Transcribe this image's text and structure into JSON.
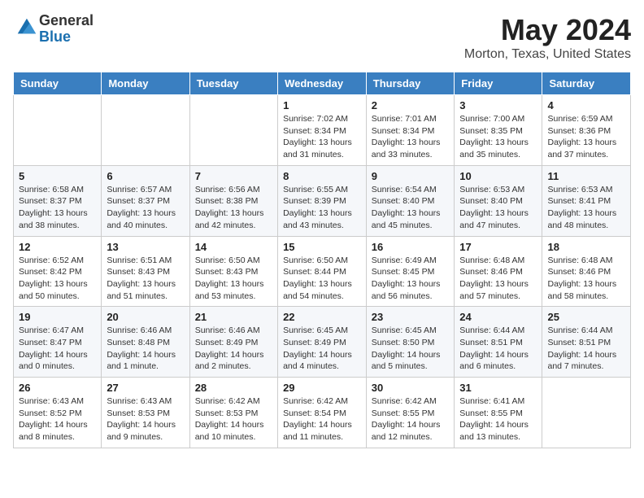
{
  "header": {
    "logo_general": "General",
    "logo_blue": "Blue",
    "title": "May 2024",
    "location": "Morton, Texas, United States"
  },
  "weekdays": [
    "Sunday",
    "Monday",
    "Tuesday",
    "Wednesday",
    "Thursday",
    "Friday",
    "Saturday"
  ],
  "weeks": [
    [
      {
        "day": "",
        "info": ""
      },
      {
        "day": "",
        "info": ""
      },
      {
        "day": "",
        "info": ""
      },
      {
        "day": "1",
        "info": "Sunrise: 7:02 AM\nSunset: 8:34 PM\nDaylight: 13 hours\nand 31 minutes."
      },
      {
        "day": "2",
        "info": "Sunrise: 7:01 AM\nSunset: 8:34 PM\nDaylight: 13 hours\nand 33 minutes."
      },
      {
        "day": "3",
        "info": "Sunrise: 7:00 AM\nSunset: 8:35 PM\nDaylight: 13 hours\nand 35 minutes."
      },
      {
        "day": "4",
        "info": "Sunrise: 6:59 AM\nSunset: 8:36 PM\nDaylight: 13 hours\nand 37 minutes."
      }
    ],
    [
      {
        "day": "5",
        "info": "Sunrise: 6:58 AM\nSunset: 8:37 PM\nDaylight: 13 hours\nand 38 minutes."
      },
      {
        "day": "6",
        "info": "Sunrise: 6:57 AM\nSunset: 8:37 PM\nDaylight: 13 hours\nand 40 minutes."
      },
      {
        "day": "7",
        "info": "Sunrise: 6:56 AM\nSunset: 8:38 PM\nDaylight: 13 hours\nand 42 minutes."
      },
      {
        "day": "8",
        "info": "Sunrise: 6:55 AM\nSunset: 8:39 PM\nDaylight: 13 hours\nand 43 minutes."
      },
      {
        "day": "9",
        "info": "Sunrise: 6:54 AM\nSunset: 8:40 PM\nDaylight: 13 hours\nand 45 minutes."
      },
      {
        "day": "10",
        "info": "Sunrise: 6:53 AM\nSunset: 8:40 PM\nDaylight: 13 hours\nand 47 minutes."
      },
      {
        "day": "11",
        "info": "Sunrise: 6:53 AM\nSunset: 8:41 PM\nDaylight: 13 hours\nand 48 minutes."
      }
    ],
    [
      {
        "day": "12",
        "info": "Sunrise: 6:52 AM\nSunset: 8:42 PM\nDaylight: 13 hours\nand 50 minutes."
      },
      {
        "day": "13",
        "info": "Sunrise: 6:51 AM\nSunset: 8:43 PM\nDaylight: 13 hours\nand 51 minutes."
      },
      {
        "day": "14",
        "info": "Sunrise: 6:50 AM\nSunset: 8:43 PM\nDaylight: 13 hours\nand 53 minutes."
      },
      {
        "day": "15",
        "info": "Sunrise: 6:50 AM\nSunset: 8:44 PM\nDaylight: 13 hours\nand 54 minutes."
      },
      {
        "day": "16",
        "info": "Sunrise: 6:49 AM\nSunset: 8:45 PM\nDaylight: 13 hours\nand 56 minutes."
      },
      {
        "day": "17",
        "info": "Sunrise: 6:48 AM\nSunset: 8:46 PM\nDaylight: 13 hours\nand 57 minutes."
      },
      {
        "day": "18",
        "info": "Sunrise: 6:48 AM\nSunset: 8:46 PM\nDaylight: 13 hours\nand 58 minutes."
      }
    ],
    [
      {
        "day": "19",
        "info": "Sunrise: 6:47 AM\nSunset: 8:47 PM\nDaylight: 14 hours\nand 0 minutes."
      },
      {
        "day": "20",
        "info": "Sunrise: 6:46 AM\nSunset: 8:48 PM\nDaylight: 14 hours\nand 1 minute."
      },
      {
        "day": "21",
        "info": "Sunrise: 6:46 AM\nSunset: 8:49 PM\nDaylight: 14 hours\nand 2 minutes."
      },
      {
        "day": "22",
        "info": "Sunrise: 6:45 AM\nSunset: 8:49 PM\nDaylight: 14 hours\nand 4 minutes."
      },
      {
        "day": "23",
        "info": "Sunrise: 6:45 AM\nSunset: 8:50 PM\nDaylight: 14 hours\nand 5 minutes."
      },
      {
        "day": "24",
        "info": "Sunrise: 6:44 AM\nSunset: 8:51 PM\nDaylight: 14 hours\nand 6 minutes."
      },
      {
        "day": "25",
        "info": "Sunrise: 6:44 AM\nSunset: 8:51 PM\nDaylight: 14 hours\nand 7 minutes."
      }
    ],
    [
      {
        "day": "26",
        "info": "Sunrise: 6:43 AM\nSunset: 8:52 PM\nDaylight: 14 hours\nand 8 minutes."
      },
      {
        "day": "27",
        "info": "Sunrise: 6:43 AM\nSunset: 8:53 PM\nDaylight: 14 hours\nand 9 minutes."
      },
      {
        "day": "28",
        "info": "Sunrise: 6:42 AM\nSunset: 8:53 PM\nDaylight: 14 hours\nand 10 minutes."
      },
      {
        "day": "29",
        "info": "Sunrise: 6:42 AM\nSunset: 8:54 PM\nDaylight: 14 hours\nand 11 minutes."
      },
      {
        "day": "30",
        "info": "Sunrise: 6:42 AM\nSunset: 8:55 PM\nDaylight: 14 hours\nand 12 minutes."
      },
      {
        "day": "31",
        "info": "Sunrise: 6:41 AM\nSunset: 8:55 PM\nDaylight: 14 hours\nand 13 minutes."
      },
      {
        "day": "",
        "info": ""
      }
    ]
  ]
}
